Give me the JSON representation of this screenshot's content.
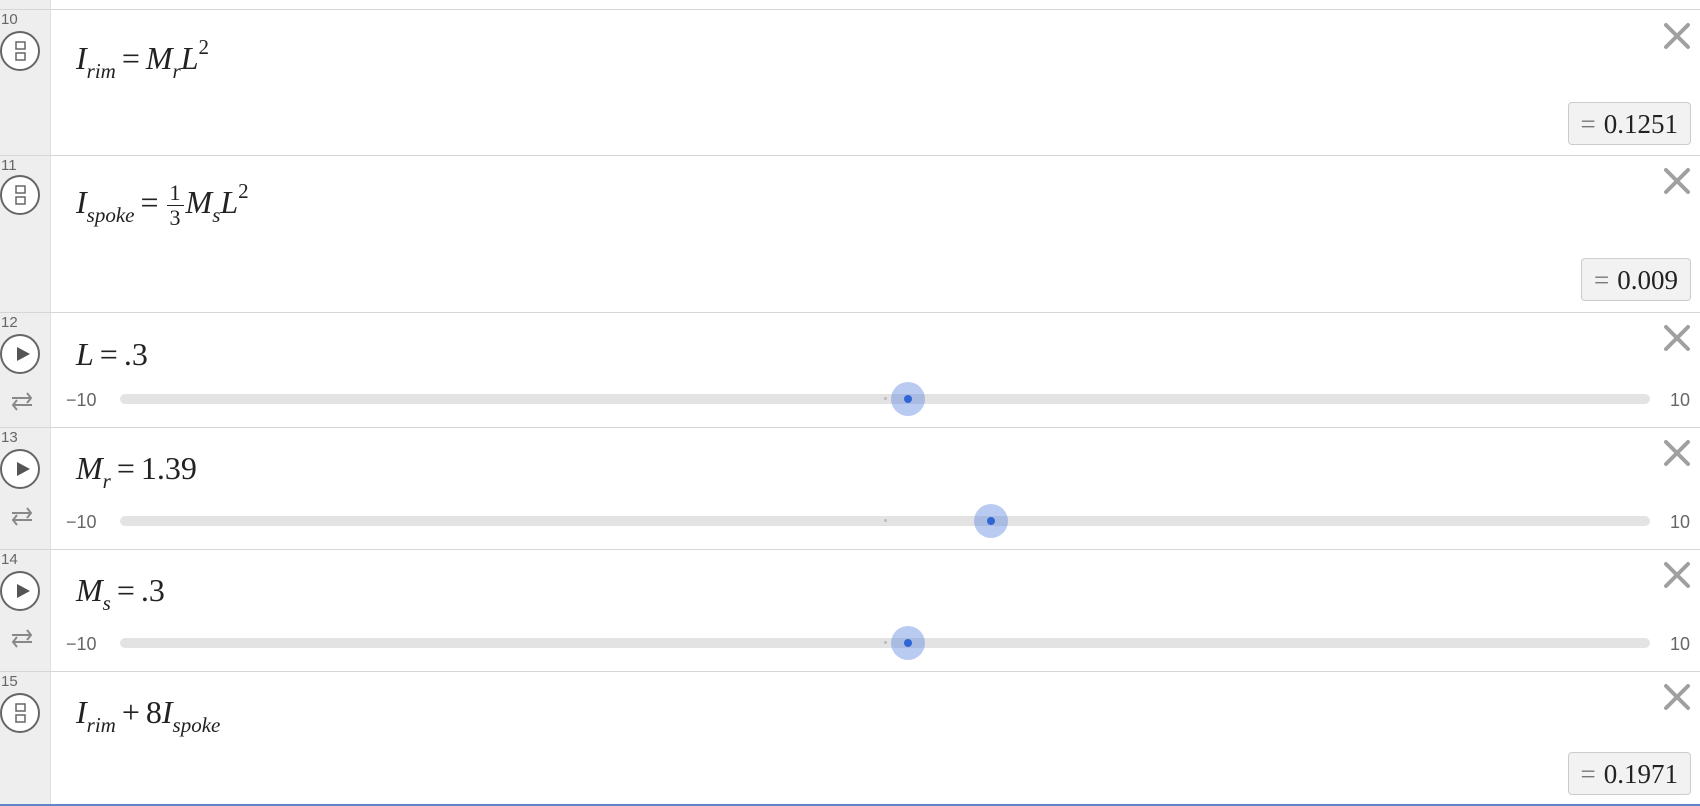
{
  "rows": [
    {
      "number": "10",
      "type": "expression",
      "lhs": {
        "base": "I",
        "sub": "rim"
      },
      "eq": "=",
      "rhs": {
        "m_base": "M",
        "m_sub": "r",
        "l": "L",
        "l_sup": "2"
      },
      "result_eq": "=",
      "result": "0.1251"
    },
    {
      "number": "11",
      "type": "expression",
      "lhs": {
        "base": "I",
        "sub": "spoke"
      },
      "eq": "=",
      "rhs": {
        "frac_num": "1",
        "frac_den": "3",
        "m_base": "M",
        "m_sub": "s",
        "l": "L",
        "l_sup": "2"
      },
      "result_eq": "=",
      "result": "0.009"
    },
    {
      "number": "12",
      "type": "slider",
      "var": {
        "base": "L",
        "sub": ""
      },
      "eq": "=",
      "value_text": ".3",
      "value": 0.3,
      "min": -10,
      "max": 10,
      "min_label": "−10",
      "max_label": "10"
    },
    {
      "number": "13",
      "type": "slider",
      "var": {
        "base": "M",
        "sub": "r"
      },
      "eq": "=",
      "value_text": "1.39",
      "value": 1.39,
      "min": -10,
      "max": 10,
      "min_label": "−10",
      "max_label": "10"
    },
    {
      "number": "14",
      "type": "slider",
      "var": {
        "base": "M",
        "sub": "s"
      },
      "eq": "=",
      "value_text": ".3",
      "value": 0.3,
      "min": -10,
      "max": 10,
      "min_label": "−10",
      "max_label": "10"
    },
    {
      "number": "15",
      "type": "expression",
      "expr": {
        "a_base": "I",
        "a_sub": "rim",
        "op": "+",
        "coef": "8",
        "b_base": "I",
        "b_sub": "spoke"
      },
      "result_eq": "=",
      "result": "0.1971"
    }
  ],
  "icons": {
    "expression_toggle": "expression-toggle-icon",
    "play": "play-icon",
    "repeat": "repeat-icon",
    "close": "close-icon"
  },
  "colors": {
    "slider_thumb": "#2f66d6",
    "slider_halo": "#5b84e0",
    "gutter": "#eeeeee",
    "bottom_accent": "#5d86c8"
  }
}
